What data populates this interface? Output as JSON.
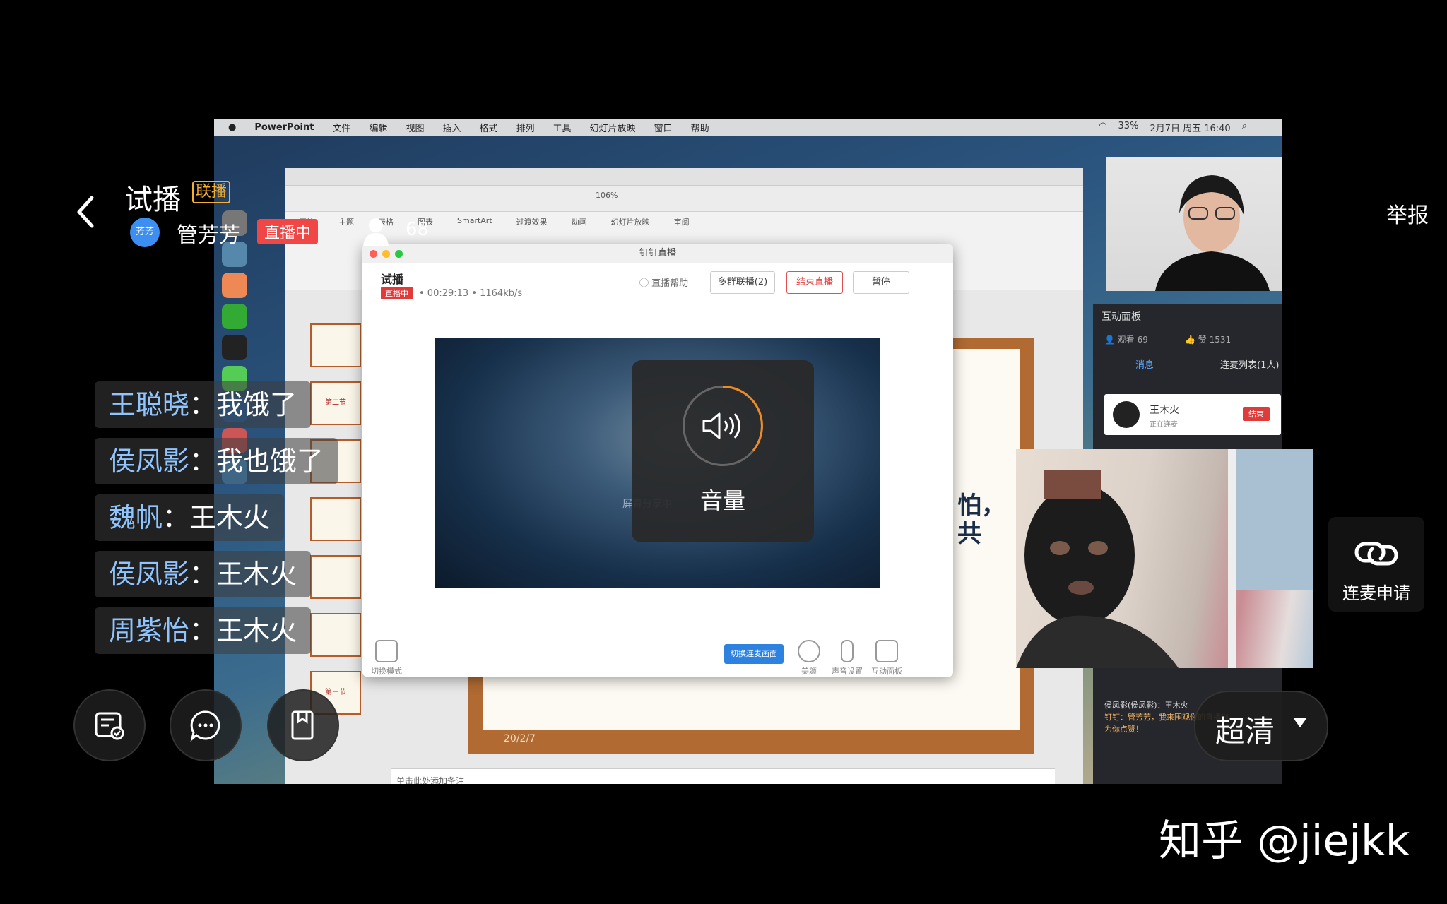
{
  "overlay": {
    "room_title": "试播",
    "lianbo_badge": "联播",
    "host_avatar_text": "芳芳",
    "host_name": "管芳芳",
    "live_status": "直播中",
    "viewer_count": "68",
    "report": "举报",
    "mic_apply": "连麦申请",
    "quality": "超清",
    "watermark": "知乎 @jiejkk"
  },
  "chat": [
    {
      "user": "王聪晓",
      "sep": "：",
      "msg": "我饿了"
    },
    {
      "user": "侯凤影",
      "sep": "：",
      "msg": "我也饿了"
    },
    {
      "user": "魏帆",
      "sep": "：",
      "msg": "王木火"
    },
    {
      "user": "侯凤影",
      "sep": "：",
      "msg": "王木火"
    },
    {
      "user": "周紫怡",
      "sep": "：",
      "msg": "王木火"
    }
  ],
  "mac_menu": [
    "PowerPoint",
    "文件",
    "编辑",
    "视图",
    "插入",
    "格式",
    "排列",
    "工具",
    "幻灯片放映",
    "窗口",
    "帮助"
  ],
  "mac_status": {
    "battery": "33%",
    "datetime": "2月7日 周五 16:40"
  },
  "ppt": {
    "tabs": [
      "开始",
      "主题",
      "表格",
      "图表",
      "SmartArt",
      "过渡效果",
      "动画",
      "幻灯片放映",
      "审阅"
    ],
    "zoom": "106%",
    "slide_date": "20/2/7",
    "slide_text": "怕，\n共",
    "notes_placeholder": "单击此处添加备注",
    "thumbs": [
      "",
      "第二节",
      "",
      "",
      "",
      "",
      "第三节"
    ]
  },
  "live_window": {
    "window_title": "钉钉直播",
    "title": "试播",
    "badge": "直播中",
    "stats": "• 00:29:13 • 1164kb/s",
    "help": "直播帮助",
    "btn_multi": "多群联播(2)",
    "btn_end": "结束直播",
    "btn_pause": "暂停",
    "share_label": "屏幕分享中",
    "switch_mode": "切换模式",
    "switch_screen": "切换连麦画面",
    "beauty": "美颜",
    "sound": "声音设置",
    "interact": "互动面板"
  },
  "volume_label": "音量",
  "panel": {
    "title": "互动面板",
    "views": "观看 69",
    "likes": "赞 1531",
    "tab_messages": "消息",
    "tab_mic_list": "连麦列表(1人)",
    "mic_user": "王木火",
    "mic_user_status": "正在连麦",
    "mic_end": "结束",
    "messages": [
      "侯凤影(侯凤影)：王木火",
      "钉钉：管芳芳，我来围观你的直播啦，",
      "为你点赞！"
    ]
  },
  "colors": {
    "live_red": "#f04646",
    "chat_user": "#8fc4ff",
    "badge_gold": "#f5b030",
    "accent_orange": "#f08a24"
  }
}
